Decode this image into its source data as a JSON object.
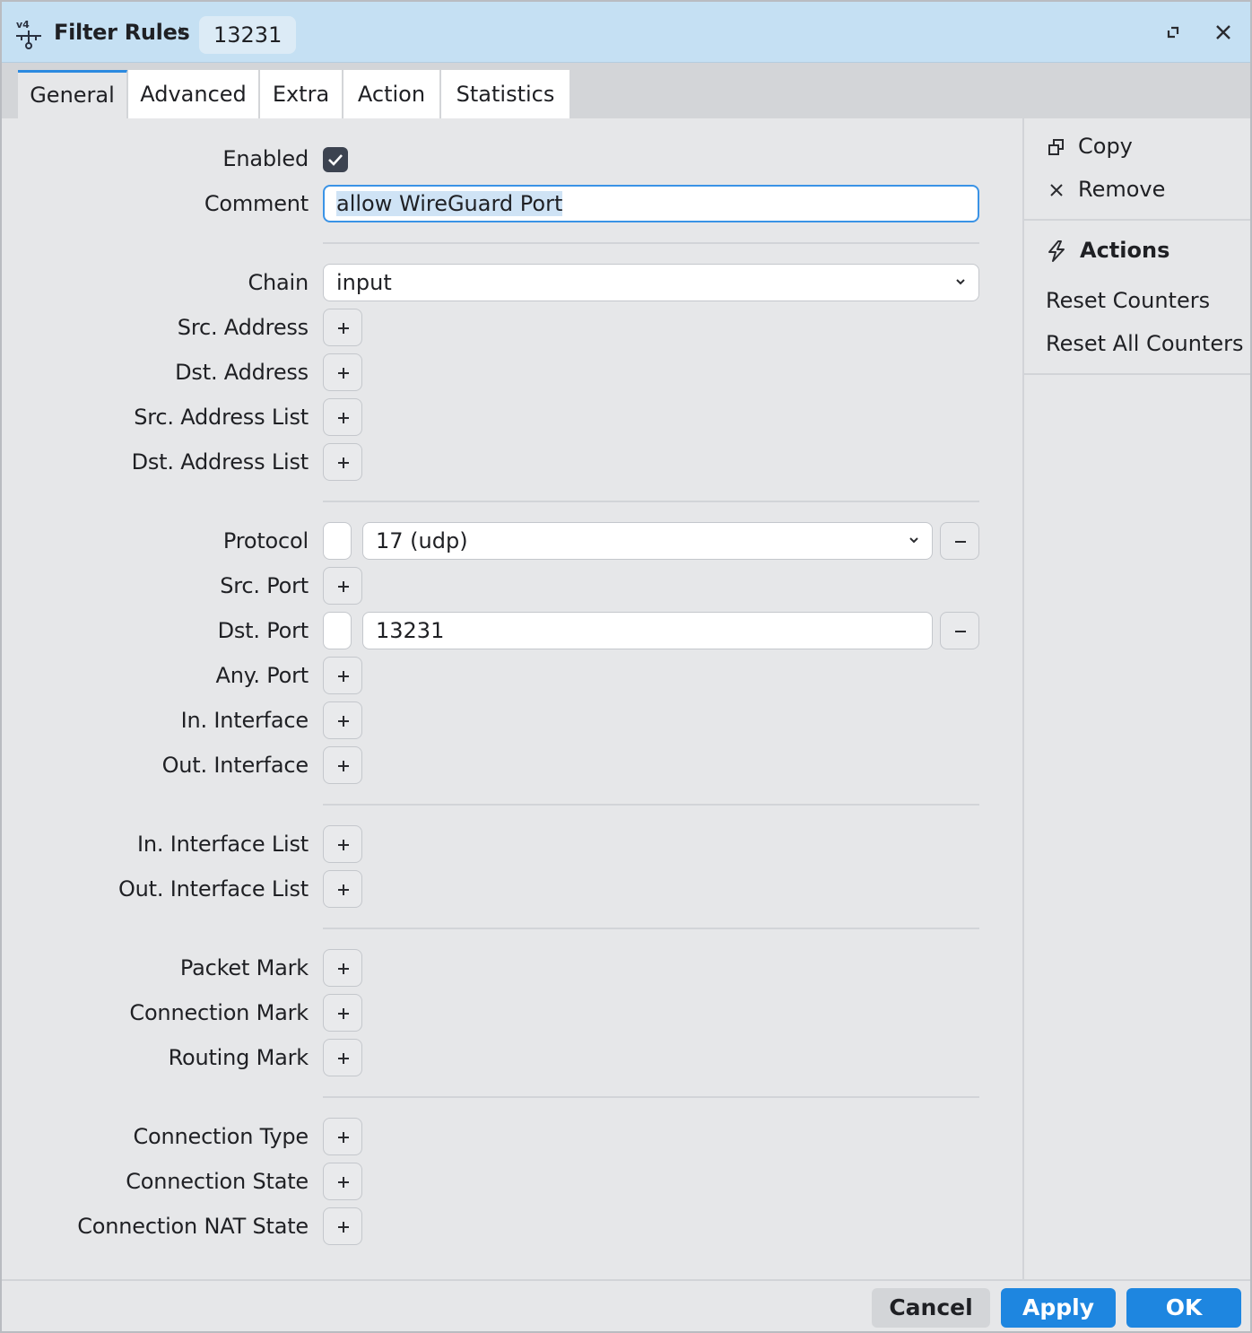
{
  "titlebar": {
    "title": "Filter Rules",
    "breadcrumb": "13231",
    "icon": "ipv4-firewall-icon"
  },
  "tabs": [
    {
      "label": "General",
      "active": true
    },
    {
      "label": "Advanced",
      "active": false
    },
    {
      "label": "Extra",
      "active": false
    },
    {
      "label": "Action",
      "active": false
    },
    {
      "label": "Statistics",
      "active": false
    }
  ],
  "form": {
    "enabled_label": "Enabled",
    "enabled_checked": true,
    "comment_label": "Comment",
    "comment_value": "allow WireGuard Port",
    "chain_label": "Chain",
    "chain_value": "input",
    "src_address_label": "Src. Address",
    "dst_address_label": "Dst. Address",
    "src_address_list_label": "Src. Address List",
    "dst_address_list_label": "Dst. Address List",
    "protocol_label": "Protocol",
    "protocol_value": "17 (udp)",
    "src_port_label": "Src. Port",
    "dst_port_label": "Dst. Port",
    "dst_port_value": "13231",
    "any_port_label": "Any. Port",
    "in_interface_label": "In. Interface",
    "out_interface_label": "Out. Interface",
    "in_interface_list_label": "In. Interface List",
    "out_interface_list_label": "Out. Interface List",
    "packet_mark_label": "Packet Mark",
    "connection_mark_label": "Connection Mark",
    "routing_mark_label": "Routing Mark",
    "connection_type_label": "Connection Type",
    "connection_state_label": "Connection State",
    "connection_nat_state_label": "Connection NAT State"
  },
  "side_panel": {
    "copy_label": "Copy",
    "remove_label": "Remove",
    "actions_heading": "Actions",
    "reset_counters_label": "Reset Counters",
    "reset_all_counters_label": "Reset All Counters"
  },
  "footer": {
    "cancel_label": "Cancel",
    "apply_label": "Apply",
    "ok_label": "OK"
  },
  "colors": {
    "titlebar_bg": "#c5e0f3",
    "accent": "#1e86e0",
    "background": "#e6e7e9"
  }
}
